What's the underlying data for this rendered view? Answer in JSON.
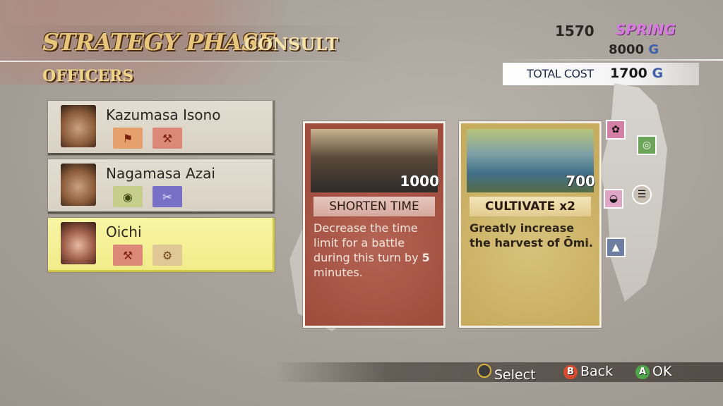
{
  "header": {
    "title": "STRATEGY PHASE",
    "subtitle": "CONSULT",
    "section": "OFFICERS",
    "year": "1570",
    "season": "SPRING",
    "gold_amount": "8000",
    "gold_unit": "G",
    "total_cost_label": "TOTAL COST",
    "total_cost_value": "1700",
    "total_cost_unit": "G"
  },
  "officers": [
    {
      "name": "Kazumasa Isono",
      "skills": [
        "strategy-icon",
        "cart-icon"
      ],
      "selected": false
    },
    {
      "name": "Nagamasa Azai",
      "skills": [
        "supply-icon",
        "build-icon"
      ],
      "selected": false
    },
    {
      "name": "Oichi",
      "skills": [
        "cart-icon",
        "labor-icon"
      ],
      "selected": true
    }
  ],
  "cards": [
    {
      "title": "SHORTEN TIME",
      "cost": "1000",
      "description_parts": [
        "Decrease the time limit for a battle during this turn by ",
        "5",
        " minutes."
      ]
    },
    {
      "title": "CULTIVATE x2",
      "cost": "700",
      "description": "Greatly increase the harvest of Ōmi."
    }
  ],
  "footer": {
    "select": "Select",
    "back": "Back",
    "ok": "OK",
    "b_button": "B",
    "a_button": "A"
  },
  "colors": {
    "title_gold": "#e7c57a",
    "season_pink": "#d77be0",
    "selected_yellow": "#f8f5a4",
    "card_red": "#9f4c3d",
    "card_gold": "#c7ac5e"
  }
}
